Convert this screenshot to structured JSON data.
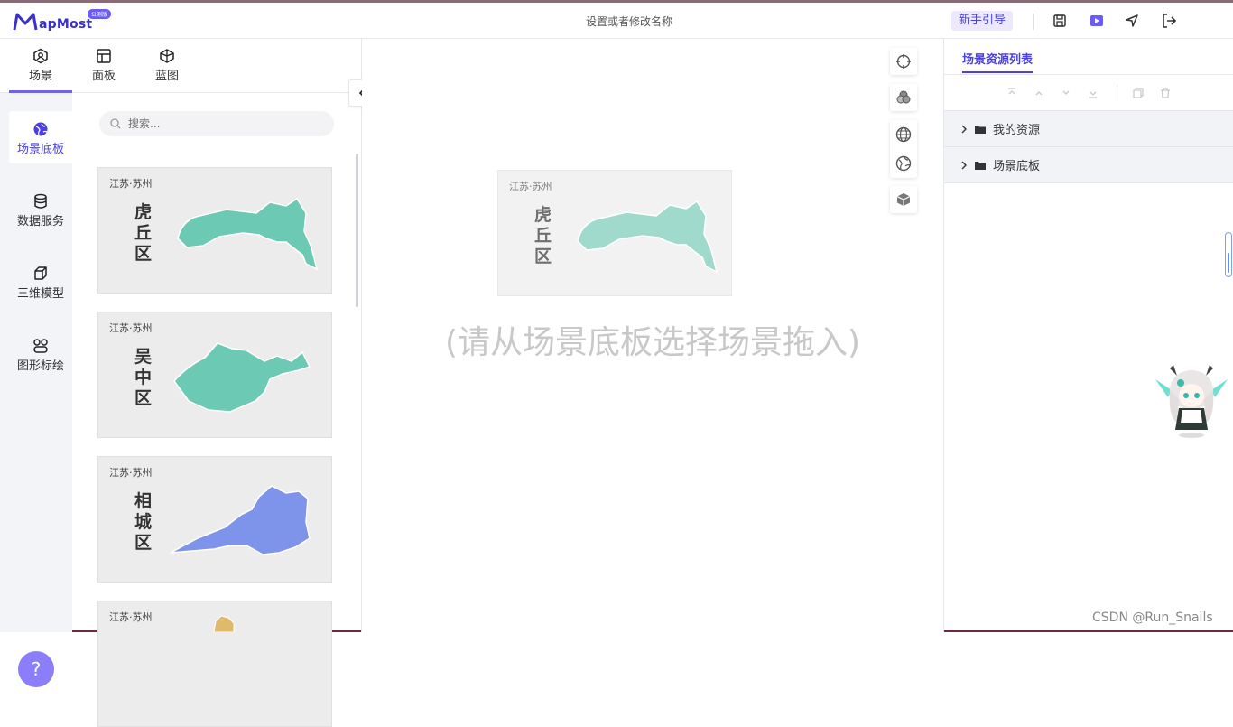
{
  "header": {
    "logo_text": "apMost",
    "logo_badge": "公测版",
    "doc_title": "设置或者修改名称",
    "guide_label": "新手引导"
  },
  "top_tabs": [
    {
      "label": "场景",
      "icon": "scene-icon"
    },
    {
      "label": "面板",
      "icon": "panel-icon"
    },
    {
      "label": "蓝图",
      "icon": "blueprint-icon"
    }
  ],
  "rail": [
    {
      "label": "场景底板",
      "icon": "globe-icon"
    },
    {
      "label": "数据服务",
      "icon": "database-icon"
    },
    {
      "label": "三维模型",
      "icon": "cube-icon"
    },
    {
      "label": "图形标绘",
      "icon": "shapes-icon"
    }
  ],
  "help_label": "?",
  "search": {
    "placeholder": "搜索..."
  },
  "cards": [
    {
      "region": "江苏·苏州",
      "district": "虎丘区",
      "color": "#6cc9b3"
    },
    {
      "region": "江苏·苏州",
      "district": "吴中区",
      "color": "#6cc9b3"
    },
    {
      "region": "江苏·苏州",
      "district": "相城区",
      "color": "#7e93ea"
    },
    {
      "region": "江苏·苏州",
      "district": "",
      "color": "#e0b96a"
    }
  ],
  "canvas": {
    "preview_region": "江苏·苏州",
    "preview_district": "虎丘区",
    "hint": "(请从场景底板选择场景拖入)"
  },
  "right_panel": {
    "tab": "场景资源列表",
    "tree": [
      {
        "label": "我的资源"
      },
      {
        "label": "场景底板"
      }
    ]
  },
  "watermark": "CSDN @Run_Snails",
  "colors": {
    "accent": "#4b3fe0",
    "teal": "#6cc9b3",
    "blue": "#7e93ea"
  }
}
